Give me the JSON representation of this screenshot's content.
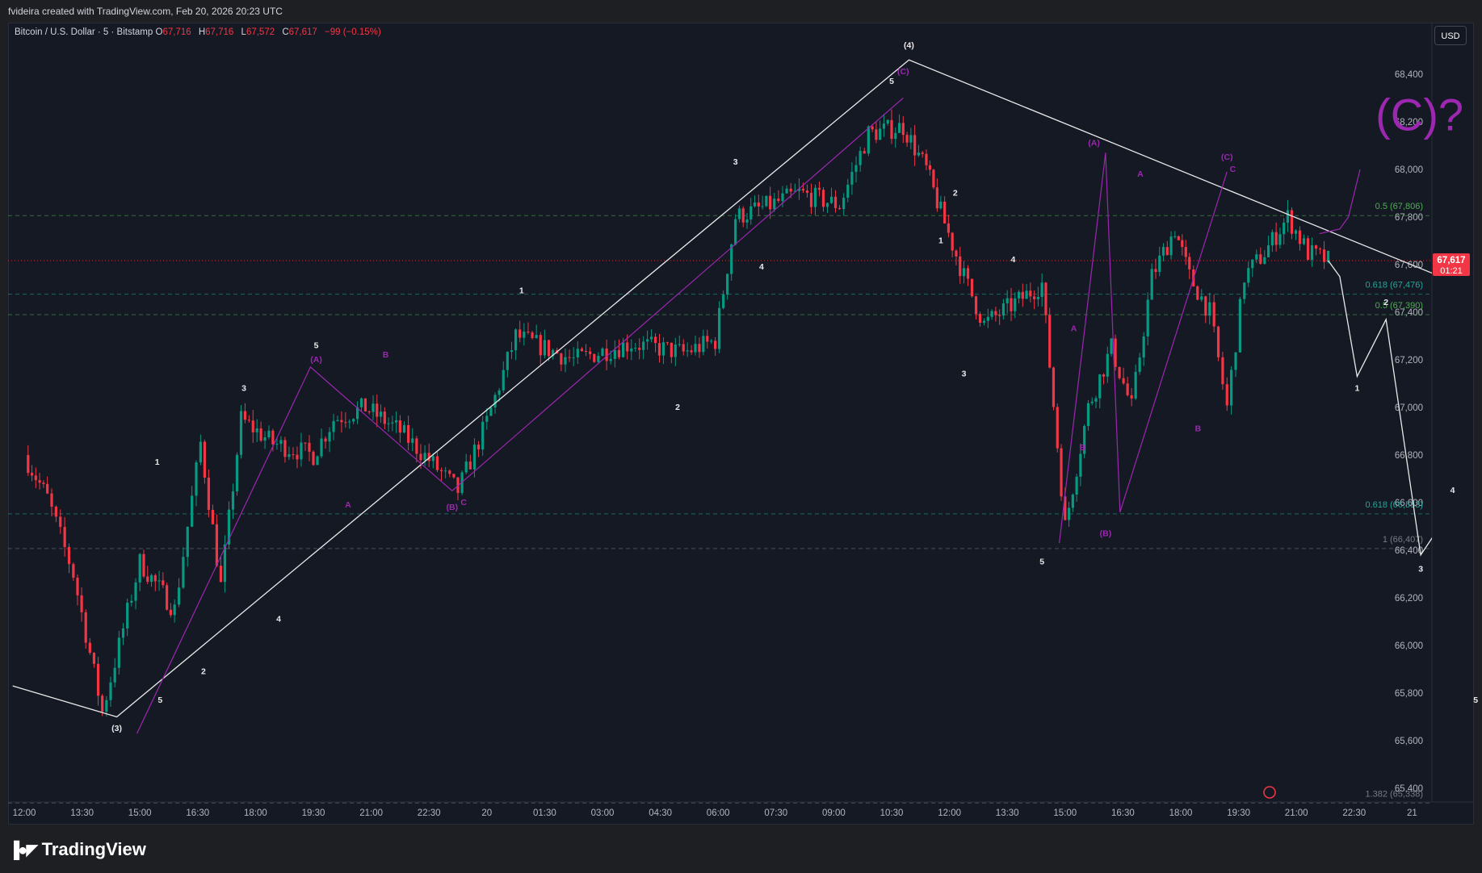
{
  "header": {
    "credit": "fvideira created with TradingView.com, Feb 20, 2026 20:23 UTC"
  },
  "legend": {
    "symbol": "Bitcoin / U.S. Dollar · 5 · Bitstamp",
    "o_label": "O",
    "o": "67,716",
    "h_label": "H",
    "h": "67,716",
    "l_label": "L",
    "l": "67,572",
    "c_label": "C",
    "c": "67,617",
    "change": "−99 (−0.15%)"
  },
  "currency_button": "USD",
  "brand": {
    "name": "TradingView"
  },
  "colors": {
    "background": "#151924",
    "up_candle": "#089981",
    "down_candle": "#f23645",
    "wave_white": "#e9e9e9",
    "wave_purple": "#9c27b0",
    "fib_green": "#4caf50",
    "fib_teal": "#26a69a",
    "fib_grey": "#787b86"
  },
  "chart_data": {
    "type": "candlestick",
    "ylim": [
      65300,
      68700
    ],
    "y_ticks": [
      65400,
      65600,
      65800,
      66000,
      66200,
      66400,
      66600,
      66800,
      67000,
      67200,
      67400,
      67600,
      67800,
      68000,
      68200,
      68400
    ],
    "y_tick_labels": [
      "65,400",
      "65,600",
      "65,800",
      "66,000",
      "66,200",
      "66,400",
      "66,600",
      "66,800",
      "67,000",
      "67,200",
      "67,400",
      "67,600",
      "67,800",
      "68,000",
      "68,200",
      "68,400"
    ],
    "x_tick_labels": [
      "12:00",
      "13:30",
      "15:00",
      "16:30",
      "18:00",
      "19:30",
      "21:00",
      "22:30",
      "20",
      "01:30",
      "03:00",
      "04:30",
      "06:00",
      "07:30",
      "09:00",
      "10:30",
      "12:00",
      "13:30",
      "15:00",
      "16:30",
      "18:00",
      "19:30",
      "21:00",
      "22:30",
      "21"
    ],
    "last_price": {
      "value": 67617,
      "label": "67,617",
      "countdown": "01:21"
    },
    "fib_levels": [
      {
        "label": "0.5 (67,806)",
        "value": 67806,
        "color": "#4caf50"
      },
      {
        "label": "0.618 (67,476)",
        "value": 67476,
        "color": "#26a69a"
      },
      {
        "label": "0.5 (67,390)",
        "value": 67390,
        "color": "#4caf50"
      },
      {
        "label": "0.618 (66,553)",
        "value": 66553,
        "color": "#26a69a"
      },
      {
        "label": "1 (66,407)",
        "value": 66407,
        "color": "#787b86"
      },
      {
        "label": "1.382 (65,338)",
        "value": 65338,
        "color": "#787b86"
      }
    ],
    "candle_path": [
      [
        0,
        66800
      ],
      [
        0.4,
        66620
      ],
      [
        0.85,
        66300
      ],
      [
        1.35,
        65720
      ],
      [
        2.0,
        66350
      ],
      [
        2.6,
        66150
      ],
      [
        3.05,
        66850
      ],
      [
        3.4,
        66250
      ],
      [
        3.75,
        66950
      ],
      [
        4.3,
        66850
      ],
      [
        5.0,
        66800
      ],
      [
        5.35,
        66950
      ],
      [
        5.9,
        67000
      ],
      [
        6.5,
        66900
      ],
      [
        7.0,
        66780
      ],
      [
        7.5,
        66650
      ],
      [
        8.0,
        66940
      ],
      [
        8.5,
        67300
      ],
      [
        9.5,
        67200
      ],
      [
        10.5,
        67270
      ],
      [
        11.4,
        67230
      ],
      [
        11.95,
        67280
      ],
      [
        12.3,
        67800
      ],
      [
        12.9,
        67850
      ],
      [
        13.4,
        67900
      ],
      [
        14.1,
        67850
      ],
      [
        14.6,
        68150
      ],
      [
        15.2,
        68180
      ],
      [
        15.6,
        68000
      ],
      [
        15.85,
        67820
      ],
      [
        16.25,
        67550
      ],
      [
        16.6,
        67350
      ],
      [
        17.2,
        67450
      ],
      [
        17.6,
        67520
      ],
      [
        18.0,
        66500
      ],
      [
        18.4,
        67000
      ],
      [
        18.8,
        67250
      ],
      [
        19.15,
        67000
      ],
      [
        19.5,
        67550
      ],
      [
        19.9,
        67750
      ],
      [
        20.15,
        67550
      ],
      [
        20.5,
        67400
      ],
      [
        20.8,
        67000
      ],
      [
        21.1,
        67550
      ],
      [
        21.45,
        67650
      ],
      [
        21.85,
        67800
      ],
      [
        22.2,
        67650
      ],
      [
        22.55,
        67617
      ]
    ],
    "projection_path": [
      [
        22.55,
        67617
      ],
      [
        22.75,
        67550
      ],
      [
        23.05,
        67130
      ],
      [
        23.55,
        67370
      ],
      [
        24.15,
        66380
      ],
      [
        24.7,
        66580
      ],
      [
        25.1,
        65830
      ]
    ],
    "waves_white_lines": [
      [
        [
          -0.2,
          65830
        ],
        [
          1.6,
          65700
        ],
        [
          15.3,
          68460
        ],
        [
          25.3,
          67470
        ]
      ]
    ],
    "waves_purple_lines": [
      [
        [
          1.95,
          65630
        ],
        [
          4.95,
          67170
        ],
        [
          7.4,
          66650
        ],
        [
          15.2,
          68300
        ]
      ],
      [
        [
          17.9,
          66430
        ],
        [
          18.7,
          68070
        ],
        [
          18.95,
          66560
        ],
        [
          20.8,
          67990
        ]
      ],
      [
        [
          22.4,
          67730
        ],
        [
          22.75,
          67750
        ],
        [
          22.9,
          67800
        ],
        [
          23.1,
          68000
        ]
      ]
    ],
    "wave_labels": [
      {
        "text": "(3)",
        "x": 1.6,
        "y": 65640,
        "color": "#e9e9e9"
      },
      {
        "text": "(4)",
        "x": 15.3,
        "y": 68510,
        "color": "#e9e9e9"
      },
      {
        "text": "1",
        "x": 2.3,
        "y": 66760,
        "color": "#e9e9e9"
      },
      {
        "text": "2",
        "x": 3.1,
        "y": 65880,
        "color": "#e9e9e9"
      },
      {
        "text": "3",
        "x": 3.8,
        "y": 67070,
        "color": "#e9e9e9"
      },
      {
        "text": "4",
        "x": 4.4,
        "y": 66100,
        "color": "#e9e9e9"
      },
      {
        "text": "5",
        "x": 2.35,
        "y": 65760,
        "color": "#e9e9e9"
      },
      {
        "text": "5",
        "x": 5.05,
        "y": 67250,
        "color": "#e9e9e9"
      },
      {
        "text": "(A)",
        "x": 5.05,
        "y": 67190,
        "color": "#9c27b0"
      },
      {
        "text": "B",
        "x": 6.25,
        "y": 67210,
        "color": "#9c27b0"
      },
      {
        "text": "A",
        "x": 5.6,
        "y": 66580,
        "color": "#9c27b0"
      },
      {
        "text": "(B)",
        "x": 7.4,
        "y": 66570,
        "color": "#9c27b0"
      },
      {
        "text": "C",
        "x": 7.6,
        "y": 66590,
        "color": "#9c27b0"
      },
      {
        "text": "1",
        "x": 8.6,
        "y": 67480,
        "color": "#e9e9e9"
      },
      {
        "text": "2",
        "x": 11.3,
        "y": 66990,
        "color": "#e9e9e9"
      },
      {
        "text": "3",
        "x": 12.3,
        "y": 68020,
        "color": "#e9e9e9"
      },
      {
        "text": "4",
        "x": 12.75,
        "y": 67580,
        "color": "#e9e9e9"
      },
      {
        "text": "5",
        "x": 15.0,
        "y": 68360,
        "color": "#e9e9e9"
      },
      {
        "text": "(C)",
        "x": 15.2,
        "y": 68400,
        "color": "#9c27b0"
      },
      {
        "text": "1",
        "x": 15.85,
        "y": 67690,
        "color": "#e9e9e9"
      },
      {
        "text": "2",
        "x": 16.1,
        "y": 67890,
        "color": "#e9e9e9"
      },
      {
        "text": "3",
        "x": 16.25,
        "y": 67130,
        "color": "#e9e9e9"
      },
      {
        "text": "4",
        "x": 17.1,
        "y": 67610,
        "color": "#e9e9e9"
      },
      {
        "text": "5",
        "x": 17.6,
        "y": 66340,
        "color": "#e9e9e9"
      },
      {
        "text": "(A)",
        "x": 18.5,
        "y": 68100,
        "color": "#9c27b0"
      },
      {
        "text": "A",
        "x": 18.15,
        "y": 67320,
        "color": "#9c27b0"
      },
      {
        "text": "B",
        "x": 18.3,
        "y": 66820,
        "color": "#9c27b0"
      },
      {
        "text": "(B)",
        "x": 18.7,
        "y": 66460,
        "color": "#9c27b0"
      },
      {
        "text": "A",
        "x": 19.3,
        "y": 67970,
        "color": "#9c27b0"
      },
      {
        "text": "B",
        "x": 20.3,
        "y": 66900,
        "color": "#9c27b0"
      },
      {
        "text": "(C)",
        "x": 20.8,
        "y": 68040,
        "color": "#9c27b0"
      },
      {
        "text": "C",
        "x": 20.9,
        "y": 67990,
        "color": "#9c27b0"
      },
      {
        "text": "1",
        "x": 23.05,
        "y": 67070,
        "color": "#e9e9e9"
      },
      {
        "text": "2",
        "x": 23.55,
        "y": 67430,
        "color": "#e9e9e9"
      },
      {
        "text": "3",
        "x": 24.15,
        "y": 66310,
        "color": "#e9e9e9"
      },
      {
        "text": "4",
        "x": 24.7,
        "y": 66640,
        "color": "#e9e9e9"
      },
      {
        "text": "5",
        "x": 25.1,
        "y": 65760,
        "color": "#e9e9e9"
      }
    ],
    "annotation": {
      "text": "(C)?",
      "x": 23.5,
      "y": 68250,
      "color": "#9c27b0"
    }
  }
}
